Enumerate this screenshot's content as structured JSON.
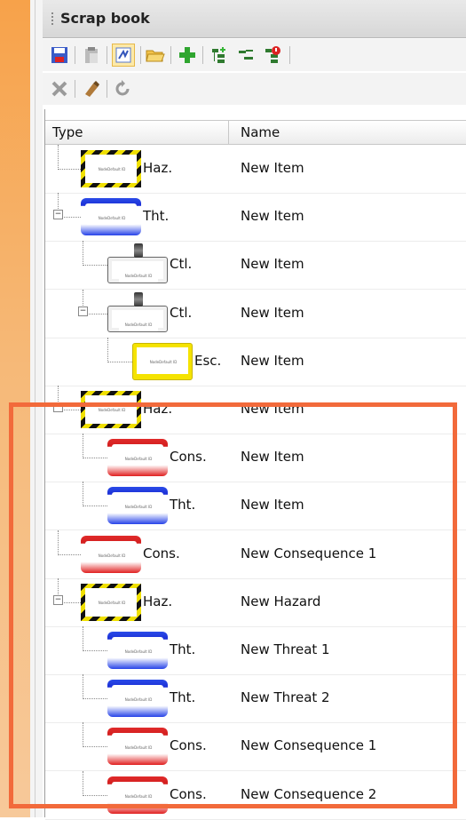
{
  "panel": {
    "title": "Scrap book"
  },
  "toolbar": {
    "row1": [
      {
        "name": "save-icon"
      },
      {
        "name": "paste-icon"
      },
      {
        "name": "auto-layout-icon",
        "active": true
      },
      {
        "name": "open-folder-icon"
      },
      {
        "name": "add-icon"
      },
      {
        "name": "add-child-icon"
      },
      {
        "name": "indent-icon"
      },
      {
        "name": "alert-icon"
      }
    ],
    "row2": [
      {
        "name": "delete-icon"
      },
      {
        "name": "clear-icon"
      },
      {
        "name": "undo-icon"
      }
    ]
  },
  "grid": {
    "headers": {
      "type": "Type",
      "name": "Name"
    },
    "rows": [
      {
        "kind": "hazard",
        "type": "Haz.",
        "name": "New Item",
        "depth": 0,
        "expander": ""
      },
      {
        "kind": "threat",
        "type": "Tht.",
        "name": "New Item",
        "depth": 0,
        "expander": "−"
      },
      {
        "kind": "control",
        "type": "Ctl.",
        "name": "New Item",
        "depth": 1,
        "expander": ""
      },
      {
        "kind": "control",
        "type": "Ctl.",
        "name": "New Item",
        "depth": 1,
        "expander": "−"
      },
      {
        "kind": "escalation",
        "type": "Esc.",
        "name": "New Item",
        "depth": 2,
        "expander": ""
      },
      {
        "kind": "hazard",
        "type": "Haz.",
        "name": "New Item",
        "depth": 0,
        "expander": "−"
      },
      {
        "kind": "consequence",
        "type": "Cons.",
        "name": "New Item",
        "depth": 1,
        "expander": ""
      },
      {
        "kind": "threat",
        "type": "Tht.",
        "name": "New Item",
        "depth": 1,
        "expander": ""
      },
      {
        "kind": "consequence",
        "type": "Cons.",
        "name": "New Consequence 1",
        "depth": 0,
        "expander": ""
      },
      {
        "kind": "hazard",
        "type": "Haz.",
        "name": "New Hazard",
        "depth": 0,
        "expander": "−"
      },
      {
        "kind": "threat",
        "type": "Tht.",
        "name": "New Threat 1",
        "depth": 1,
        "expander": ""
      },
      {
        "kind": "threat",
        "type": "Tht.",
        "name": "New Threat 2",
        "depth": 1,
        "expander": ""
      },
      {
        "kind": "consequence",
        "type": "Cons.",
        "name": "New Consequence 1",
        "depth": 1,
        "expander": ""
      },
      {
        "kind": "consequence",
        "type": "Cons.",
        "name": "New Consequence 2",
        "depth": 1,
        "expander": ""
      }
    ]
  },
  "thumbnail_caption": "NodeDefault ID",
  "colors": {
    "highlight": "#f26a3b",
    "hazard_stripe_a": "#111111",
    "hazard_stripe_b": "#f0e000",
    "threat": "#2642e8",
    "consequence": "#e02020",
    "escalation": "#f5e300"
  }
}
